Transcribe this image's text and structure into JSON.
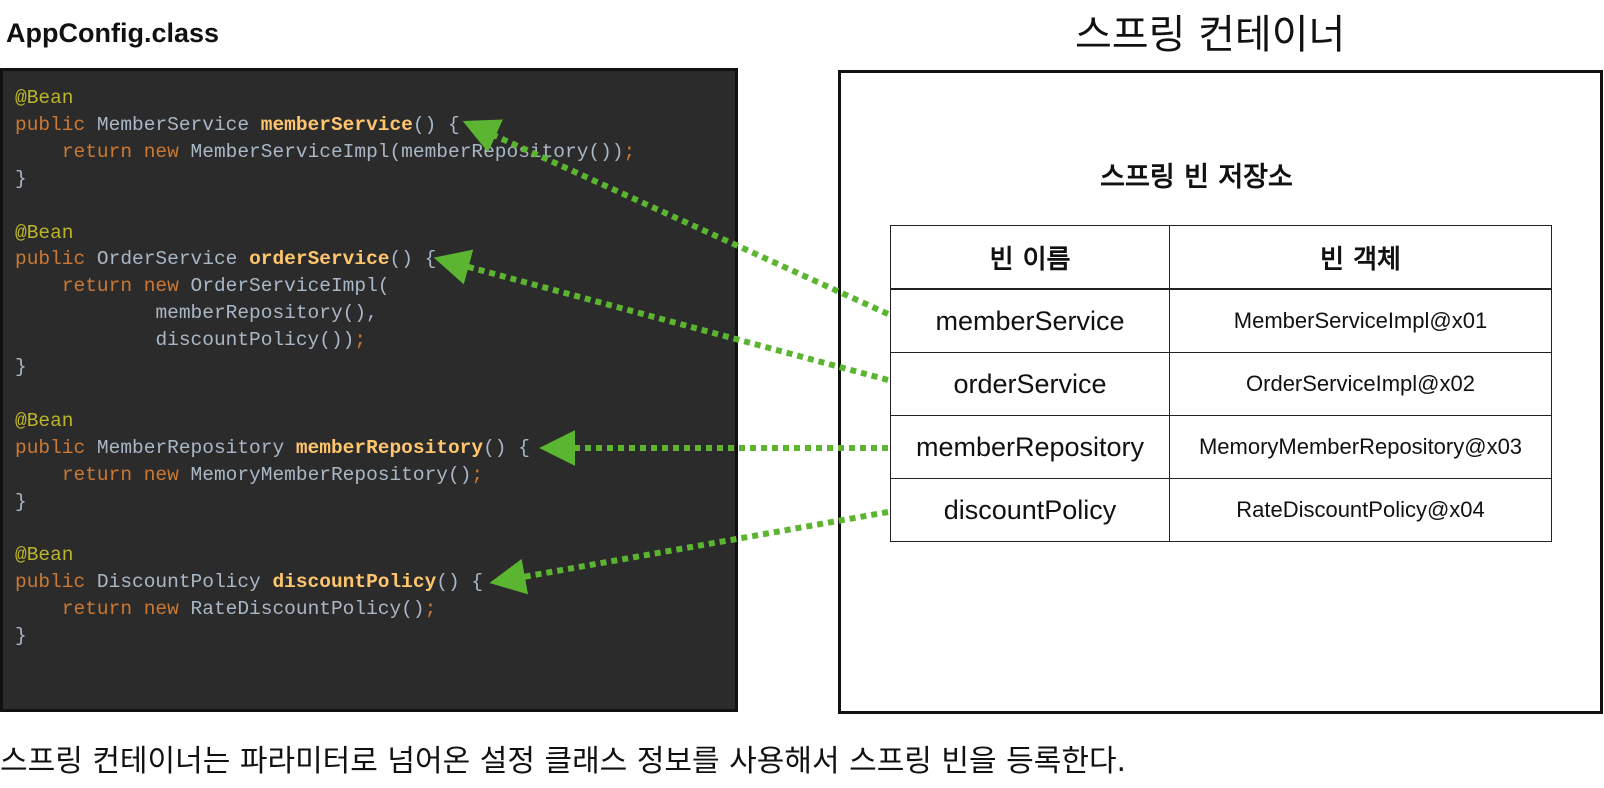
{
  "code_panel": {
    "title": "AppConfig.class",
    "beans": [
      {
        "annotation": "@Bean",
        "public_kw": "public",
        "return_type": "MemberService",
        "method": "memberService",
        "signature_rest": "() {",
        "body_lines": [
          {
            "return_kw": "return",
            "new_kw": "new",
            "rest": "MemberServiceImpl(memberRepository())",
            "semi": ";"
          }
        ],
        "closing": "}"
      },
      {
        "annotation": "@Bean",
        "public_kw": "public",
        "return_type": "OrderService",
        "method": "orderService",
        "signature_rest": "() {",
        "body_lines": [
          {
            "return_kw": "return",
            "new_kw": "new",
            "rest": "OrderServiceImpl(",
            "semi": ""
          },
          {
            "indent_text": "memberRepository(),"
          },
          {
            "indent_text": "discountPolicy())",
            "semi": ";"
          }
        ],
        "closing": "}"
      },
      {
        "annotation": "@Bean",
        "public_kw": "public",
        "return_type": "MemberRepository",
        "method": "memberRepository",
        "signature_rest": "() {",
        "body_lines": [
          {
            "return_kw": "return",
            "new_kw": "new",
            "rest": "MemoryMemberRepository()",
            "semi": ";"
          }
        ],
        "closing": "}"
      },
      {
        "annotation": "@Bean",
        "public_kw": "public",
        "return_type": "DiscountPolicy",
        "method": "discountPolicy",
        "signature_rest": "() {",
        "body_lines": [
          {
            "return_kw": "return",
            "new_kw": "new",
            "rest": "RateDiscountPolicy()",
            "semi": ";"
          }
        ],
        "closing": "}"
      }
    ]
  },
  "container": {
    "title": "스프링 컨테이너",
    "registry_title": "스프링 빈 저장소",
    "table": {
      "headers": [
        "빈 이름",
        "빈 객체"
      ],
      "rows": [
        {
          "name": "memberService",
          "object": "MemberServiceImpl@x01"
        },
        {
          "name": "orderService",
          "object": "OrderServiceImpl@x02"
        },
        {
          "name": "memberRepository",
          "object": "MemoryMemberRepository@x03"
        },
        {
          "name": "discountPolicy",
          "object": "RateDiscountPolicy@x04"
        }
      ]
    }
  },
  "caption": "스프링 컨테이너는 파라미터로 넘어온 설정 클래스 정보를 사용해서 스프링 빈을 등록한다.",
  "colors": {
    "code_background": "#2b2b2b",
    "annotation": "#bbb529",
    "keyword": "#cc7832",
    "method_name": "#ffc66d",
    "plain_code": "#a9b7c6",
    "arrow": "#5cb531"
  }
}
